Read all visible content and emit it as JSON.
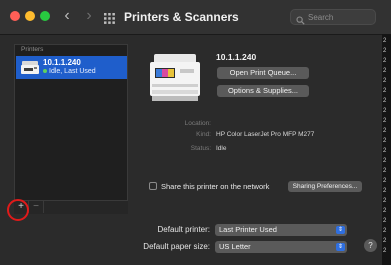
{
  "window": {
    "title": "Printers & Scanners"
  },
  "search": {
    "placeholder": "Search"
  },
  "printers_list": {
    "header": "Printers",
    "items": [
      {
        "name": "10.1.1.240",
        "status": "Idle, Last Used"
      }
    ],
    "add_label": "+",
    "remove_label": "−"
  },
  "detail": {
    "name": "10.1.1.240",
    "open_queue_label": "Open Print Queue...",
    "options_label": "Options & Supplies...",
    "location_label": "Location:",
    "location_value": "",
    "kind_label": "Kind:",
    "kind_value": "HP Color LaserJet Pro MFP M277",
    "status_label": "Status:",
    "status_value": "Idle",
    "share_label": "Share this printer on the network",
    "sharing_prefs_label": "Sharing Preferences..."
  },
  "footer": {
    "default_printer_label": "Default printer:",
    "default_printer_value": "Last Printer Used",
    "default_paper_label": "Default paper size:",
    "default_paper_value": "US Letter"
  },
  "help_label": "?",
  "edge_glyphs": [
    "2",
    "2",
    "2",
    "2",
    "2",
    "2",
    "2",
    "2",
    "2",
    "2",
    "2",
    "2",
    "2",
    "2",
    "2",
    "2",
    "2",
    "2",
    "2",
    "2",
    "2",
    "2"
  ],
  "colors": {
    "accent": "#1f5ecb",
    "close": "#ff5f57",
    "minimize": "#febc2e",
    "zoom": "#28c840",
    "highlight_ring": "#e01a1a"
  }
}
